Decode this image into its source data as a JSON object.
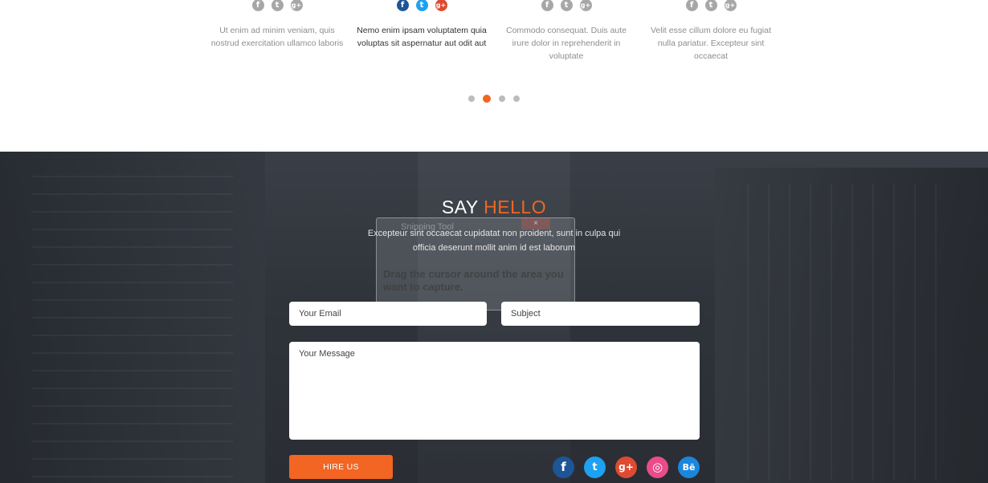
{
  "team": {
    "members": [
      {
        "text": "Ut enim ad minim veniam, quis nostrud exercitation ullamco laboris",
        "active": false
      },
      {
        "text": "Nemo enim ipsam voluptatem quia voluptas sit aspernatur aut odit aut",
        "active": true
      },
      {
        "text": "Commodo consequat. Duis aute irure dolor in reprehenderit in voluptate",
        "active": false
      },
      {
        "text": "Velit esse cillum dolore eu fugiat nulla pariatur. Excepteur sint occaecat",
        "active": false
      }
    ],
    "social_icons": {
      "facebook": "f",
      "twitter": "t",
      "google_plus": "g+"
    },
    "slider": {
      "count": 4,
      "active_index": 1
    }
  },
  "contact": {
    "title_plain": "SAY",
    "title_accent": "HELLO",
    "subtitle": "Excepteur sint occaecat cupidatat non proident, sunt in culpa qui officia deserunt mollit anim id est laborum",
    "form": {
      "email_placeholder": "Your Email",
      "subject_placeholder": "Subject",
      "message_placeholder": "Your Message",
      "submit_label": "HIRE US"
    },
    "socials": [
      {
        "name": "facebook",
        "glyph": "f"
      },
      {
        "name": "twitter",
        "glyph": "t"
      },
      {
        "name": "google-plus",
        "glyph": "g+"
      },
      {
        "name": "dribbble",
        "glyph": "◎"
      },
      {
        "name": "behance",
        "glyph": "Bē"
      }
    ]
  },
  "overlay": {
    "title": "Snipping Tool",
    "close_glyph": "×",
    "message": "Drag the cursor around the area you want to capture."
  },
  "colors": {
    "accent": "#f26522",
    "facebook": "#1d5597",
    "twitter": "#1da1f2",
    "google_plus": "#df4a32",
    "dribbble": "#ea4c89",
    "behance": "#1b87dc"
  }
}
